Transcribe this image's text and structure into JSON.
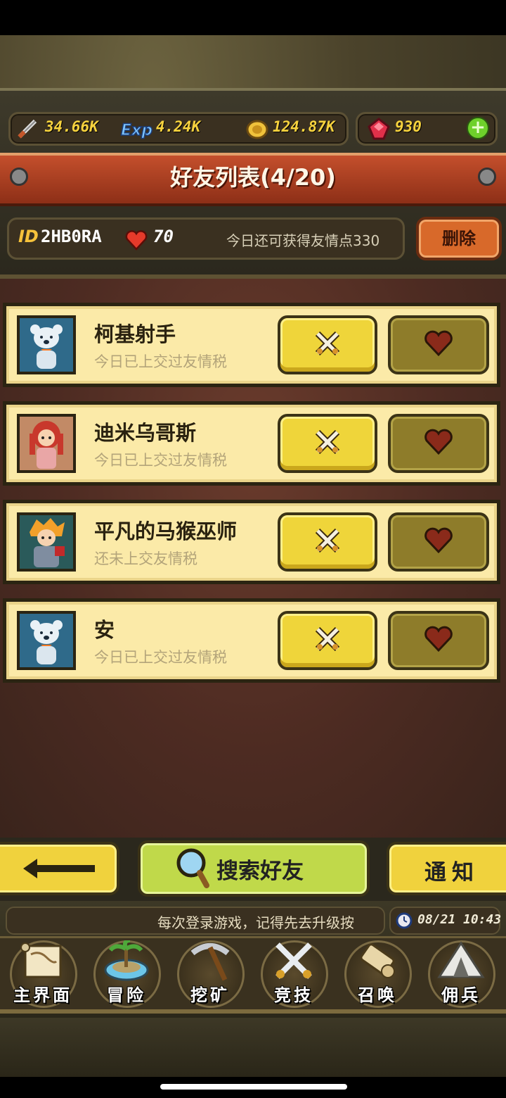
{
  "resources": {
    "attack": "34.66K",
    "exp": "4.24K",
    "gold": "124.87K",
    "gems": "930",
    "add_label": "+"
  },
  "title": "好友列表(4/20)",
  "player": {
    "id_label": "ID",
    "id_value": "2HB0RA",
    "hearts": "70",
    "quota_text": "今日还可获得友情点330",
    "delete_label": "删除"
  },
  "friends": [
    {
      "name": "柯基射手",
      "status": "今日已上交过友情税",
      "avatar": "polar-bear"
    },
    {
      "name": "迪米乌哥斯",
      "status": "今日已上交过友情税",
      "avatar": "red-hair-girl"
    },
    {
      "name": "平凡的马猴巫师",
      "status": "还未上交友情税",
      "avatar": "orange-hair-knight"
    },
    {
      "name": "安",
      "status": "今日已上交过友情税",
      "avatar": "polar-bear"
    }
  ],
  "actions": {
    "back_icon": "arrow-left-icon",
    "search_label": "搜索好友",
    "notify_label": "通知"
  },
  "ticker": {
    "text": "每次登录游戏，记得先去升级按",
    "time": "08/21 10:43"
  },
  "nav": [
    {
      "label": "主界面",
      "icon": "scroll-map-icon"
    },
    {
      "label": "冒险",
      "icon": "island-icon"
    },
    {
      "label": "挖矿",
      "icon": "pickaxe-icon"
    },
    {
      "label": "竞技",
      "icon": "crossed-swords-icon"
    },
    {
      "label": "召唤",
      "icon": "summon-scroll-icon"
    },
    {
      "label": "佣兵",
      "icon": "tent-icon"
    }
  ],
  "colors": {
    "title_red": "#c44f2c",
    "card_bg": "#fbeaa8",
    "fight_yellow": "#efd53a",
    "like_olive": "#8e7c2a",
    "gold_text": "#f6d23e"
  }
}
